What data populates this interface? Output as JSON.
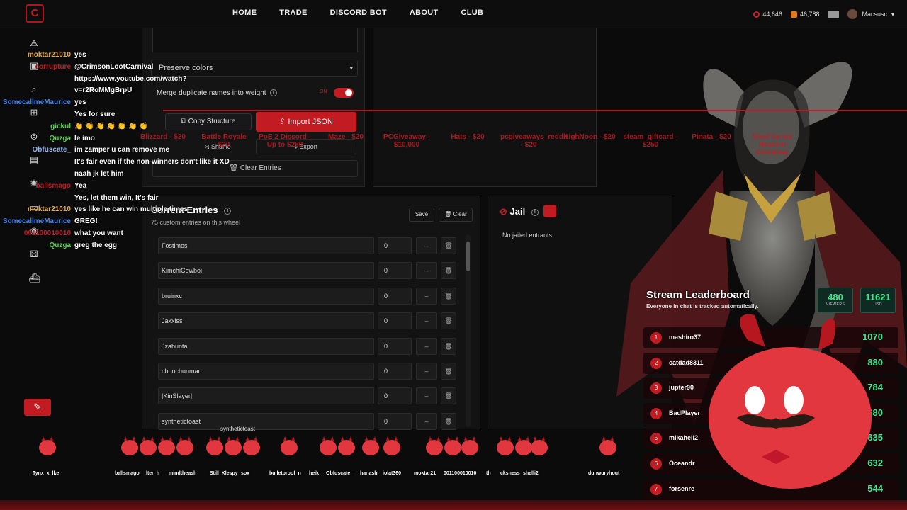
{
  "nav": {
    "logo": "C",
    "links": [
      "HOME",
      "TRADE",
      "DISCORD BOT",
      "ABOUT",
      "CLUB"
    ],
    "stat1": "44,646",
    "stat2": "46,788",
    "username": "Macsusc",
    "user_caret": "▾",
    "colors": {
      "accent": "#c21b22"
    }
  },
  "rail": {
    "icons": [
      "share-icon",
      "search-icon",
      "gift-icon",
      "target-icon",
      "puzzle-icon",
      "shield-icon",
      "timer-icon",
      "layers-icon",
      "chip-icon",
      "drawer-icon",
      "dice-icon",
      "ship-icon",
      "wand-icon"
    ]
  },
  "settings": {
    "color_mode": "Preserve colors",
    "merge_label": "Merge duplicate names into weight",
    "toggle_on": "ON",
    "copy_label": "Copy Structure",
    "import_label": "Import JSON",
    "shuffle_label": "Shuffle",
    "export_label": "Export",
    "clear_entries_label": "Clear Entries"
  },
  "entries": {
    "title": "Current Entries",
    "subtitle": "75 custom entries on this wheel",
    "save_label": "Save",
    "clear_label": "Clear",
    "minus": "–",
    "trash": "🗑",
    "items": [
      {
        "name": "Fostimos",
        "weight": "0"
      },
      {
        "name": "KimchiCowboi",
        "weight": "0"
      },
      {
        "name": "bruinxc",
        "weight": "0"
      },
      {
        "name": "Jaxxiss",
        "weight": "0"
      },
      {
        "name": "Jzabunta",
        "weight": "0"
      },
      {
        "name": "chunchunmaru",
        "weight": "0"
      },
      {
        "name": "|KinSlayer|",
        "weight": "0"
      },
      {
        "name": "synthetictoast",
        "weight": "0"
      }
    ]
  },
  "jail": {
    "title": "Jail",
    "empty": "No jailed entrants."
  },
  "chat": [
    {
      "user": "moktar21010",
      "msg": "yes",
      "color": "#e0a84a"
    },
    {
      "user": "corrupture",
      "msg": "@CrimsonLootCarnival",
      "color": "#c21b22"
    },
    {
      "user": "",
      "msg": "https://www.youtube.com/watch?",
      "color": "#fff"
    },
    {
      "user": "",
      "msg": "v=r2RoMMgBrpU",
      "color": "#fff"
    },
    {
      "user": "SomecallmeMaurice",
      "msg": "yes",
      "color": "#3b7ef0"
    },
    {
      "user": "",
      "msg": "Yes for sure",
      "color": "#3b7ef0"
    },
    {
      "user": "gickul",
      "msg": "👏 👏 👏 👏 👏 👏 👏",
      "color": "#57d14a"
    },
    {
      "user": "Quzga",
      "msg": "le imo",
      "color": "#57d14a"
    },
    {
      "user": "Obfuscate_",
      "msg": "im zamper u can remove me",
      "color": "#8fb3e8"
    },
    {
      "user": "",
      "msg": "It's fair even if the non-winners don't like it XD",
      "color": "#3b7ef0"
    },
    {
      "user": "",
      "msg": "naah jk let him",
      "color": "#3b7ef0"
    },
    {
      "user": "ballsmago",
      "msg": "Yea",
      "color": "#c21b22"
    },
    {
      "user": "",
      "msg": "Yes, let them win, It's fair",
      "color": "#3b7ef0"
    },
    {
      "user": "moktar21010",
      "msg": "yes like he can win multiple times",
      "color": "#e0a84a"
    },
    {
      "user": "SomecallmeMaurice",
      "msg": "GREG!",
      "color": "#3b7ef0"
    },
    {
      "user": "001100010010",
      "msg": "what you want",
      "color": "#c21b22"
    },
    {
      "user": "Quzga",
      "msg": "greg the egg",
      "color": "#57d14a"
    }
  ],
  "ticker": [
    "Blizzard - $20",
    "Battle Royale $20",
    "PoE 2 Discord - Up to $250",
    "Maze - $20",
    "PCGiveaway - $10,000",
    "Hats - $20",
    "pcgiveaways_reddit - $20",
    "HighNoon - $20",
    "steam_giftcard - $250",
    "Pinata - $20",
    "Steel Series Headset Giveaway"
  ],
  "leaderboard": {
    "title": "Stream Leaderboard",
    "subtitle": "Everyone in chat is tracked automatically.",
    "viewers": "480",
    "viewers_label": "VIEWERS",
    "usd": "11621",
    "usd_label": "USD",
    "rows": [
      {
        "rank": "1",
        "name": "mashiro37",
        "score": "1070"
      },
      {
        "rank": "2",
        "name": "catdad8311",
        "score": "880"
      },
      {
        "rank": "3",
        "name": "jupter90",
        "score": "784"
      },
      {
        "rank": "4",
        "name": "BadPlayer",
        "score": "680"
      },
      {
        "rank": "5",
        "name": "mikahell2",
        "score": "635"
      },
      {
        "rank": "6",
        "name": "Oceandr",
        "score": "632"
      },
      {
        "rank": "7",
        "name": "forsenre",
        "score": "544"
      }
    ]
  },
  "strip": {
    "current": "synthetictoast",
    "names": [
      "Tynx_x_lke",
      "ballsmago",
      "lter_h",
      "mindtheash",
      "Still_Klespy",
      "sox",
      "bulletproof_n",
      "heik",
      "Obfuscate_",
      "hanash",
      "iolat360",
      "moktar21",
      "001100010010",
      "th",
      "cksness",
      "shelli2",
      "dunwuryhout"
    ]
  }
}
